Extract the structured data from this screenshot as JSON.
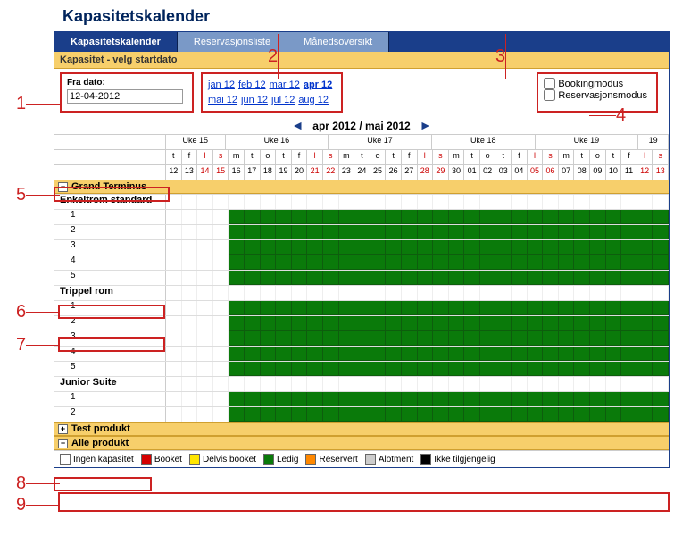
{
  "title": "Kapasitetskalender",
  "tabs": [
    "Kapasitetskalender",
    "Reservasjonsliste",
    "Månedsoversikt"
  ],
  "activeTab": 0,
  "sectionBar": "Kapasitet - velg startdato",
  "fra": {
    "label": "Fra dato:",
    "value": "12-04-2012"
  },
  "monthLinks": [
    {
      "t": "jan 12"
    },
    {
      "t": "feb 12"
    },
    {
      "t": "mar 12"
    },
    {
      "t": "apr 12",
      "current": true
    },
    {
      "t": "mai 12"
    },
    {
      "t": "jun 12"
    },
    {
      "t": "jul 12"
    },
    {
      "t": "aug 12"
    }
  ],
  "modes": {
    "booking": "Bookingmodus",
    "reserv": "Reservasjonsmodus"
  },
  "nav": {
    "label": "apr 2012 / mai 2012"
  },
  "weeks": [
    {
      "label": "Uke 15",
      "size": "first"
    },
    {
      "label": "Uke 16",
      "size": ""
    },
    {
      "label": "Uke 17",
      "size": ""
    },
    {
      "label": "Uke 18",
      "size": ""
    },
    {
      "label": "Uke 19",
      "size": ""
    },
    {
      "label": "19",
      "size": "small"
    }
  ],
  "days": [
    "t",
    "f",
    "l",
    "s",
    "m",
    "t",
    "o",
    "t",
    "f",
    "l",
    "s",
    "m",
    "t",
    "o",
    "t",
    "f",
    "l",
    "s",
    "m",
    "t",
    "o",
    "t",
    "f",
    "l",
    "s",
    "m",
    "t",
    "o",
    "t",
    "f",
    "l",
    "s"
  ],
  "wkIdx": [
    2,
    3,
    9,
    10,
    16,
    17,
    23,
    24,
    30,
    31
  ],
  "nums": [
    "12",
    "13",
    "14",
    "15",
    "16",
    "17",
    "18",
    "19",
    "20",
    "21",
    "22",
    "23",
    "24",
    "25",
    "26",
    "27",
    "28",
    "29",
    "30",
    "01",
    "02",
    "03",
    "04",
    "05",
    "06",
    "07",
    "08",
    "09",
    "10",
    "11",
    "12",
    "13"
  ],
  "groups": [
    {
      "name": "Grand Terminus",
      "open": true,
      "highlight": true,
      "cats": [
        {
          "name": "Enkeltrom standard",
          "rooms": 5
        },
        {
          "name": "Trippel rom",
          "rooms": 5,
          "highlightName": true,
          "highlightRoom": 2
        },
        {
          "name": "Junior Suite",
          "rooms": 2
        }
      ]
    },
    {
      "name": "Test produkt",
      "open": false
    },
    {
      "name": "Alle produkt",
      "open": true,
      "highlightToggle": true
    }
  ],
  "legend": [
    {
      "c": "#ffffff",
      "t": "Ingen kapasitet"
    },
    {
      "c": "#d40000",
      "t": "Booket"
    },
    {
      "c": "#ffe600",
      "t": "Delvis booket"
    },
    {
      "c": "#0a7a0a",
      "t": "Ledig"
    },
    {
      "c": "#ff8800",
      "t": "Reservert"
    },
    {
      "c": "#cccccc",
      "t": "Alotment"
    },
    {
      "c": "#000000",
      "t": "Ikke tilgjengelig"
    }
  ],
  "emptyLead": 4,
  "callouts": [
    "1",
    "2",
    "3",
    "4",
    "5",
    "6",
    "7",
    "8",
    "9"
  ]
}
